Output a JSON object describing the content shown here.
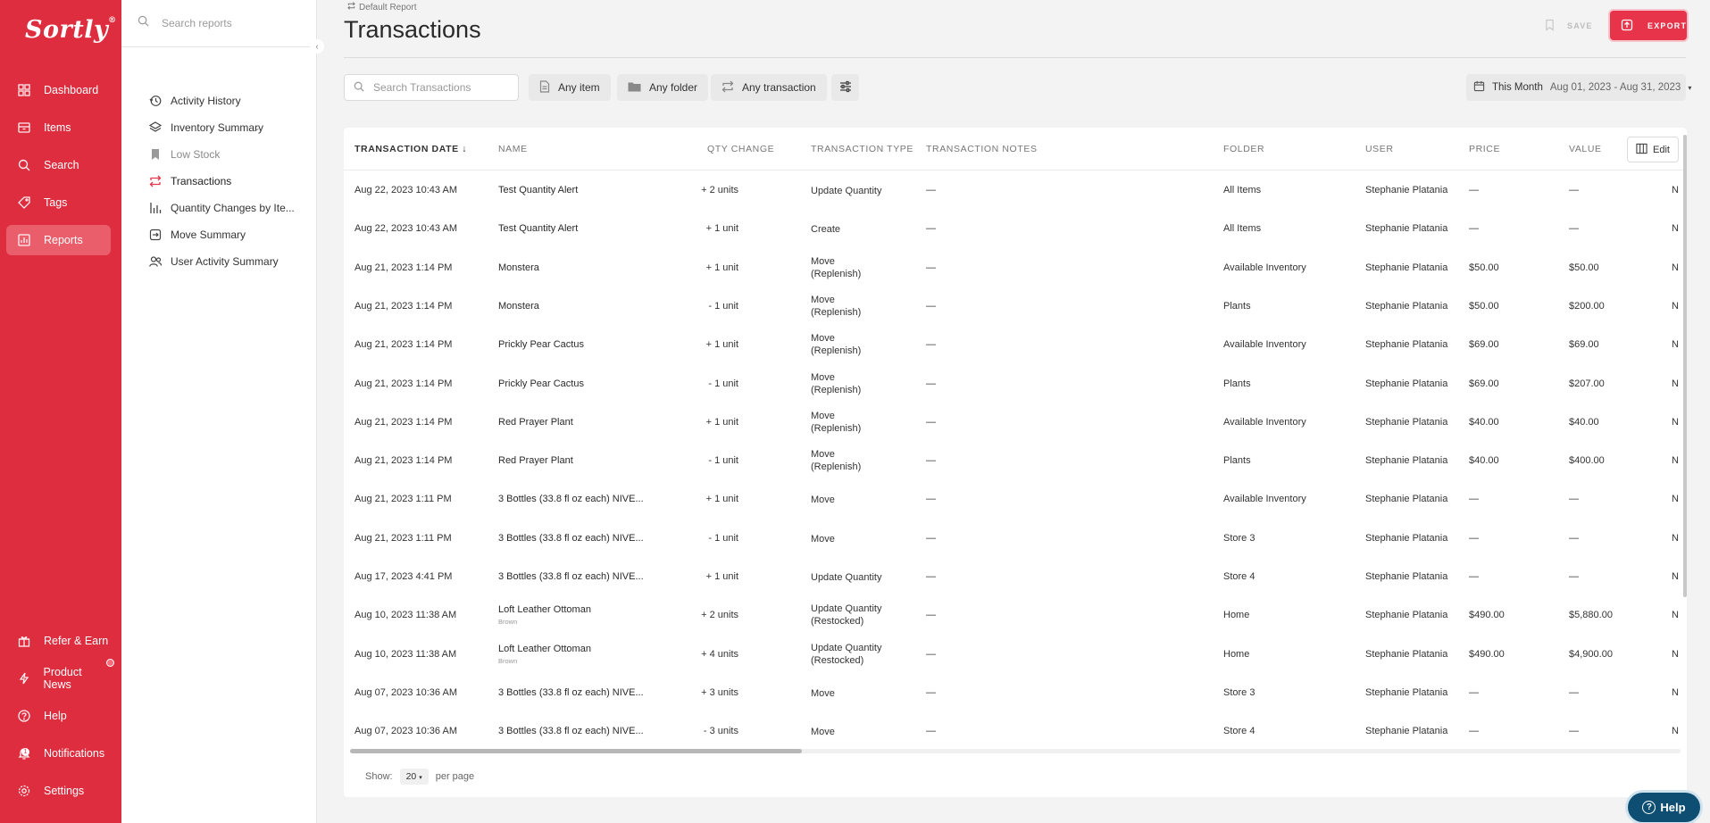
{
  "brand": {
    "logo_text": "Sortly",
    "logo_mark": "®"
  },
  "nav": {
    "items": [
      {
        "label": "Dashboard",
        "icon": "dashboard-icon"
      },
      {
        "label": "Items",
        "icon": "items-icon"
      },
      {
        "label": "Search",
        "icon": "search-icon"
      },
      {
        "label": "Tags",
        "icon": "tag-icon"
      },
      {
        "label": "Reports",
        "icon": "reports-icon",
        "active": true
      }
    ],
    "bottom_items": [
      {
        "label": "Refer & Earn",
        "icon": "gift-icon"
      },
      {
        "label": "Product News",
        "icon": "bolt-icon"
      },
      {
        "label": "Help",
        "icon": "help-icon"
      },
      {
        "label": "Notifications",
        "icon": "bell-icon",
        "badge": "1"
      },
      {
        "label": "Settings",
        "icon": "gear-icon"
      }
    ]
  },
  "sidebar": {
    "search_placeholder": "Search reports",
    "items": [
      {
        "label": "Activity History",
        "icon": "history-icon"
      },
      {
        "label": "Inventory Summary",
        "icon": "layers-icon"
      },
      {
        "label": "Low Stock",
        "icon": "bookmark-icon"
      },
      {
        "label": "Transactions",
        "icon": "transfer-icon"
      },
      {
        "label": "Quantity Changes by Ite...",
        "icon": "bar-chart-icon"
      },
      {
        "label": "Move Summary",
        "icon": "move-icon"
      },
      {
        "label": "User Activity Summary",
        "icon": "users-icon"
      }
    ]
  },
  "header": {
    "breadcrumb": "Default Report",
    "title": "Transactions",
    "save_label": "SAVE",
    "export_label": "EXPORT"
  },
  "filters": {
    "search_placeholder": "Search Transactions",
    "item_label": "Any item",
    "folder_label": "Any folder",
    "transaction_label": "Any transaction",
    "date_preset": "This Month",
    "date_range": "Aug 01, 2023 - Aug 31, 2023"
  },
  "table": {
    "columns": {
      "date": "TRANSACTION DATE",
      "name": "NAME",
      "qty": "QTY CHANGE",
      "type": "TRANSACTION TYPE",
      "notes": "TRANSACTION NOTES",
      "folder": "FOLDER",
      "user": "USER",
      "price": "PRICE",
      "value": "VALUE"
    },
    "edit_label": "Edit",
    "rows": [
      {
        "date": "Aug 22, 2023 10:43 AM",
        "name": "Test Quantity Alert",
        "sub": "",
        "qty": "+ 2  units",
        "type1": "Update Quantity",
        "type2": "",
        "notes": "—",
        "folder": "All Items",
        "user": "Stephanie Platania",
        "price": "—",
        "value": "—",
        "extra": "N"
      },
      {
        "date": "Aug 22, 2023 10:43 AM",
        "name": "Test Quantity Alert",
        "sub": "",
        "qty": "+ 1  unit",
        "type1": "Create",
        "type2": "",
        "notes": "—",
        "folder": "All Items",
        "user": "Stephanie Platania",
        "price": "—",
        "value": "—",
        "extra": "N"
      },
      {
        "date": "Aug 21, 2023 1:14 PM",
        "name": "Monstera",
        "sub": "",
        "qty": "+ 1  unit",
        "type1": "Move",
        "type2": "(Replenish)",
        "notes": "—",
        "folder": "Available Inventory",
        "user": "Stephanie Platania",
        "price": "$50.00",
        "value": "$50.00",
        "extra": "N"
      },
      {
        "date": "Aug 21, 2023 1:14 PM",
        "name": "Monstera",
        "sub": "",
        "qty": "- 1  unit",
        "type1": "Move",
        "type2": "(Replenish)",
        "notes": "—",
        "folder": "Plants",
        "user": "Stephanie Platania",
        "price": "$50.00",
        "value": "$200.00",
        "extra": "N"
      },
      {
        "date": "Aug 21, 2023 1:14 PM",
        "name": "Prickly Pear Cactus",
        "sub": "",
        "qty": "+ 1  unit",
        "type1": "Move",
        "type2": "(Replenish)",
        "notes": "—",
        "folder": "Available Inventory",
        "user": "Stephanie Platania",
        "price": "$69.00",
        "value": "$69.00",
        "extra": "N"
      },
      {
        "date": "Aug 21, 2023 1:14 PM",
        "name": "Prickly Pear Cactus",
        "sub": "",
        "qty": "- 1  unit",
        "type1": "Move",
        "type2": "(Replenish)",
        "notes": "—",
        "folder": "Plants",
        "user": "Stephanie Platania",
        "price": "$69.00",
        "value": "$207.00",
        "extra": "N"
      },
      {
        "date": "Aug 21, 2023 1:14 PM",
        "name": "Red Prayer Plant",
        "sub": "",
        "qty": "+ 1  unit",
        "type1": "Move",
        "type2": "(Replenish)",
        "notes": "—",
        "folder": "Available Inventory",
        "user": "Stephanie Platania",
        "price": "$40.00",
        "value": "$40.00",
        "extra": "N"
      },
      {
        "date": "Aug 21, 2023 1:14 PM",
        "name": "Red Prayer Plant",
        "sub": "",
        "qty": "- 1  unit",
        "type1": "Move",
        "type2": "(Replenish)",
        "notes": "—",
        "folder": "Plants",
        "user": "Stephanie Platania",
        "price": "$40.00",
        "value": "$400.00",
        "extra": "N"
      },
      {
        "date": "Aug 21, 2023 1:11 PM",
        "name": "3 Bottles (33.8 fl oz each) NIVE...",
        "sub": "",
        "qty": "+ 1  unit",
        "type1": "Move",
        "type2": "",
        "notes": "—",
        "folder": "Available Inventory",
        "user": "Stephanie Platania",
        "price": "—",
        "value": "—",
        "extra": "N"
      },
      {
        "date": "Aug 21, 2023 1:11 PM",
        "name": "3 Bottles (33.8 fl oz each) NIVE...",
        "sub": "",
        "qty": "- 1  unit",
        "type1": "Move",
        "type2": "",
        "notes": "—",
        "folder": "Store 3",
        "user": "Stephanie Platania",
        "price": "—",
        "value": "—",
        "extra": "N"
      },
      {
        "date": "Aug 17, 2023 4:41 PM",
        "name": "3 Bottles (33.8 fl oz each) NIVE...",
        "sub": "",
        "qty": "+ 1  unit",
        "type1": "Update Quantity",
        "type2": "",
        "notes": "—",
        "folder": "Store 4",
        "user": "Stephanie Platania",
        "price": "—",
        "value": "—",
        "extra": "N"
      },
      {
        "date": "Aug 10, 2023 11:38 AM",
        "name": "Loft Leather Ottoman",
        "sub": "Brown",
        "qty": "+ 2  units",
        "type1": "Update Quantity",
        "type2": "(Restocked)",
        "notes": "—",
        "folder": "Home",
        "user": "Stephanie Platania",
        "price": "$490.00",
        "value": "$5,880.00",
        "extra": "N"
      },
      {
        "date": "Aug 10, 2023 11:38 AM",
        "name": "Loft Leather Ottoman",
        "sub": "Brown",
        "qty": "+ 4  units",
        "type1": "Update Quantity",
        "type2": "(Restocked)",
        "notes": "—",
        "folder": "Home",
        "user": "Stephanie Platania",
        "price": "$490.00",
        "value": "$4,900.00",
        "extra": "N"
      },
      {
        "date": "Aug 07, 2023 10:36 AM",
        "name": "3 Bottles (33.8 fl oz each) NIVE...",
        "sub": "",
        "qty": "+ 3  units",
        "type1": "Move",
        "type2": "",
        "notes": "—",
        "folder": "Store 3",
        "user": "Stephanie Platania",
        "price": "—",
        "value": "—",
        "extra": "N"
      },
      {
        "date": "Aug 07, 2023 10:36 AM",
        "name": "3 Bottles (33.8 fl oz each) NIVE...",
        "sub": "",
        "qty": "- 3  units",
        "type1": "Move",
        "type2": "",
        "notes": "—",
        "folder": "Store 4",
        "user": "Stephanie Platania",
        "price": "—",
        "value": "—",
        "extra": "N"
      }
    ]
  },
  "pager": {
    "show_label": "Show:",
    "page_size": "20",
    "per_page_label": "per page"
  },
  "help_button": {
    "label": "Help"
  },
  "colors": {
    "brand": "#dd2d3f",
    "export": "#e8344a",
    "help": "#0e4e72"
  }
}
